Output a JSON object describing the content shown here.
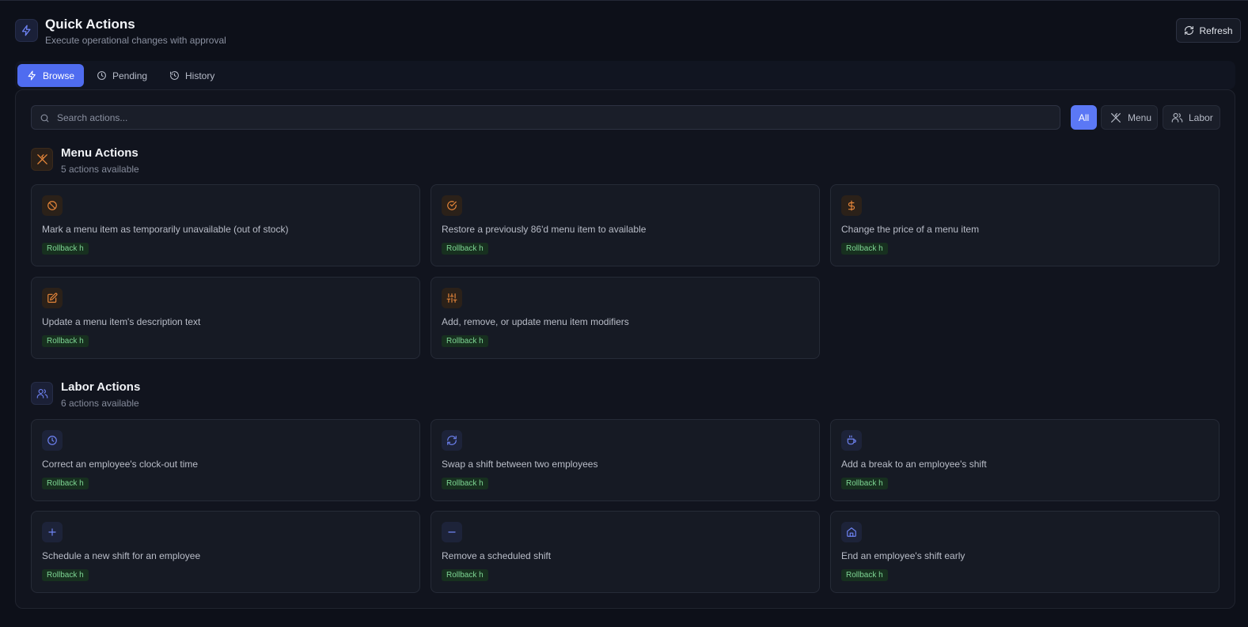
{
  "colors": {
    "accent": "#4f6cf0",
    "menu_accent": "#e8873a",
    "labor_accent": "#6f84f5",
    "rollback": "#7ed694"
  },
  "header": {
    "title": "Quick Actions",
    "subtitle": "Execute operational changes with approval",
    "refresh_label": "Refresh",
    "icon": "bolt-icon"
  },
  "tabs": [
    {
      "label": "Browse",
      "icon": "bolt-icon",
      "active": true
    },
    {
      "label": "Pending",
      "icon": "clock-icon",
      "active": false
    },
    {
      "label": "History",
      "icon": "history-icon",
      "active": false
    }
  ],
  "search": {
    "placeholder": "Search actions...",
    "value": ""
  },
  "filters": [
    {
      "label": "All",
      "active": true
    },
    {
      "label": "Menu",
      "icon": "utensils-icon",
      "active": false
    },
    {
      "label": "Labor",
      "icon": "users-icon",
      "active": false
    }
  ],
  "sections": [
    {
      "title": "Menu Actions",
      "subtitle": "5 actions available",
      "icon": "utensils-icon",
      "actions": [
        {
          "description": "Mark a menu item as temporarily unavailable (out of stock)",
          "badge": "Rollback h",
          "icon": "ban-icon"
        },
        {
          "description": "Restore a previously 86'd menu item to available",
          "badge": "Rollback h",
          "icon": "check-circle-icon"
        },
        {
          "description": "Change the price of a menu item",
          "badge": "Rollback h",
          "icon": "dollar-icon"
        },
        {
          "description": "Update a menu item's description text",
          "badge": "Rollback h",
          "icon": "edit-icon"
        },
        {
          "description": "Add, remove, or update menu item modifiers",
          "badge": "Rollback h",
          "icon": "sliders-icon"
        }
      ]
    },
    {
      "title": "Labor Actions",
      "subtitle": "6 actions available",
      "icon": "users-icon",
      "actions": [
        {
          "description": "Correct an employee's clock-out time",
          "badge": "Rollback h",
          "icon": "clock-icon"
        },
        {
          "description": "Swap a shift between two employees",
          "badge": "Rollback h",
          "icon": "refresh-icon"
        },
        {
          "description": "Add a break to an employee's shift",
          "badge": "Rollback h",
          "icon": "coffee-icon"
        },
        {
          "description": "Schedule a new shift for an employee",
          "badge": "Rollback h",
          "icon": "plus-icon"
        },
        {
          "description": "Remove a scheduled shift",
          "badge": "Rollback h",
          "icon": "minus-icon"
        },
        {
          "description": "End an employee's shift early",
          "badge": "Rollback h",
          "icon": "home-icon"
        }
      ]
    }
  ]
}
